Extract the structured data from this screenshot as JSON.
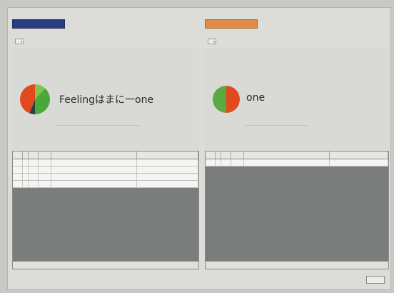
{
  "left_panel": {
    "tab_label": "",
    "filter": {
      "label": "",
      "value": ""
    },
    "headline": "Feelingはまに一one",
    "pie": {
      "values": [
        12,
        38,
        6,
        44
      ],
      "colors": [
        "#7ec34a",
        "#4aa83a",
        "#2a3e4a",
        "#e24a1e"
      ]
    },
    "grid": {
      "headers": [
        "",
        "",
        "",
        "",
        "",
        ""
      ],
      "rows": [
        [
          "",
          "",
          "",
          "",
          "",
          ""
        ],
        [
          "",
          "",
          "",
          "",
          "",
          ""
        ],
        [
          "",
          "",
          "",
          "",
          "",
          ""
        ],
        [
          "",
          "",
          "",
          "",
          "",
          ""
        ]
      ],
      "footer_left": "",
      "footer_right": ""
    }
  },
  "right_panel": {
    "tab_label": "",
    "filter": {
      "label": "",
      "value": ""
    },
    "headline": "one",
    "side_note": "",
    "pie": {
      "values": [
        50,
        50
      ],
      "colors": [
        "#e24a1e",
        "#5aaa44"
      ]
    },
    "grid": {
      "headers": [
        "",
        "",
        "",
        "",
        "",
        ""
      ],
      "rows": [
        [
          "",
          "",
          "",
          "",
          "",
          ""
        ]
      ],
      "footer_left": "",
      "footer_right": ""
    }
  },
  "bottom_button_label": ""
}
